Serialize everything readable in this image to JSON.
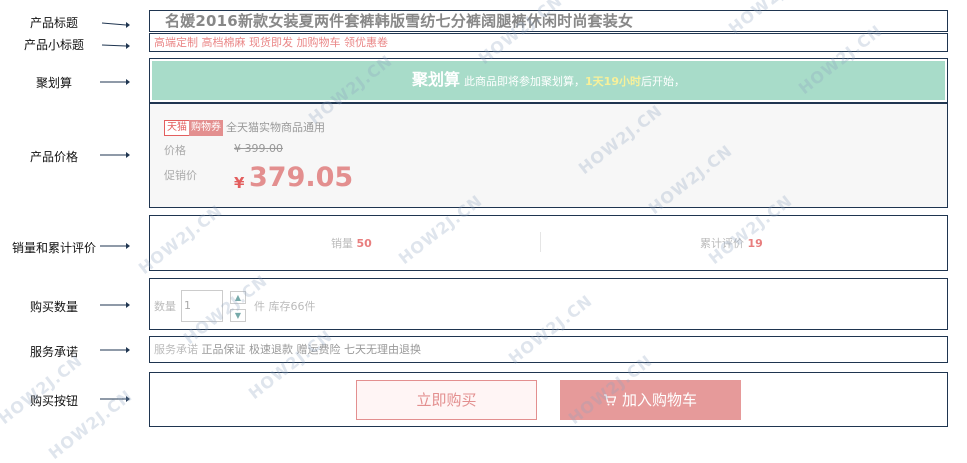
{
  "labels": {
    "title": "产品标题",
    "subtitle": "产品小标题",
    "juhuasuan": "聚划算",
    "price": "产品价格",
    "sales": "销量和累计评价",
    "quantity": "购买数量",
    "service": "服务承诺",
    "buy": "购买按钮"
  },
  "product": {
    "title": "名媛2016新款女装夏两件套裤韩版雪纺七分裤阔腿裤休闲时尚套装女",
    "subtitle": "高端定制 高档棉麻 现货即发 加购物车 领优惠卷"
  },
  "juhuasuan": {
    "title": "聚划算",
    "text_before": "此商品即将参加聚划算，",
    "countdown": "1天19小时",
    "text_after": "后开始，"
  },
  "price": {
    "tag_tmall": "天猫",
    "tag_coupon": "购物券",
    "coupon_note": "全天猫实物商品通用",
    "original_label": "价格",
    "original_value": "¥ 399.00",
    "promo_label": "促销价",
    "promo_currency": "¥",
    "promo_value": "379.05"
  },
  "sales": {
    "volume_label": "销量",
    "volume_value": "50",
    "reviews_label": "累计评价",
    "reviews_value": "19"
  },
  "quantity": {
    "label": "数量",
    "value": "1",
    "up": "▲",
    "down": "▼",
    "stock": "件 库存66件"
  },
  "service": {
    "label": "服务承诺",
    "items": "正品保证 极速退款 赠运费险 七天无理由退换"
  },
  "buttons": {
    "buy_now": "立即购买",
    "add_cart": "加入购物车"
  },
  "watermark": "HOW2J.CN",
  "colors": {
    "accent": "#e35e5e",
    "juhuasuan_bg": "#a8dcc9",
    "border": "#1f3550"
  }
}
